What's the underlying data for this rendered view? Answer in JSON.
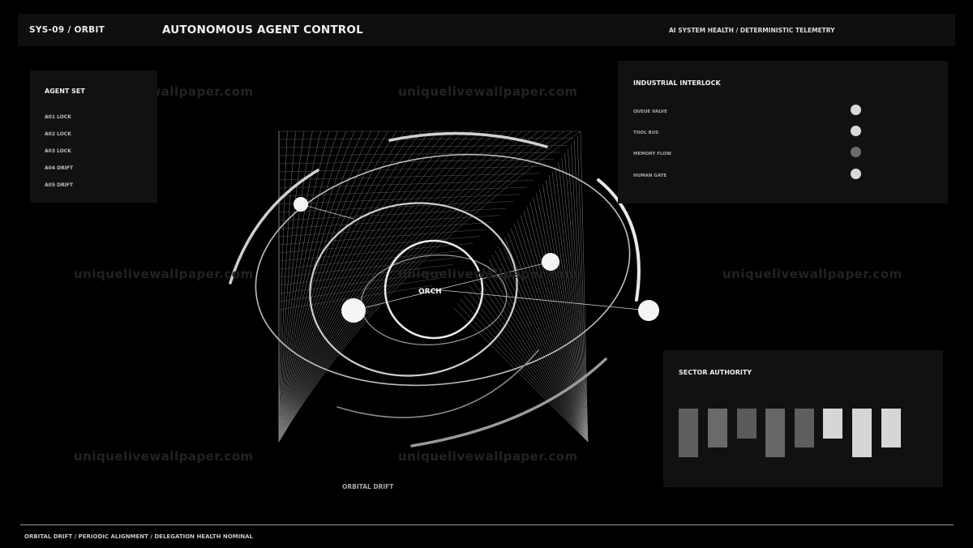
{
  "header": {
    "system_id": "SYS-09 / ORBIT",
    "title": "AUTONOMOUS AGENT CONTROL",
    "health": "AI SYSTEM HEALTH / DETERMINISTIC TELEMETRY"
  },
  "agent_set": {
    "title": "AGENT SET",
    "items": [
      "A01 LOCK",
      "A02 LOCK",
      "A03 LOCK",
      "A04 DRIFT",
      "A05 DRIFT"
    ]
  },
  "interlock": {
    "title": "INDUSTRIAL INTERLOCK",
    "items": [
      {
        "label": "QUEUE VALVE",
        "color": "#d9d9d9"
      },
      {
        "label": "TOOL BUS",
        "color": "#d9d9d9"
      },
      {
        "label": "MEMORY FLOW",
        "color": "#6b6b6b"
      },
      {
        "label": "HUMAN GATE",
        "color": "#d9d9d9"
      }
    ]
  },
  "sector_authority": {
    "title": "SECTOR AUTHORITY"
  },
  "orbit": {
    "center_label": "ORCH",
    "caption": "ORBITAL DRIFT"
  },
  "footer": {
    "text": "ORBITAL DRIFT / PERIODIC ALIGNMENT / DELEGATION HEALTH NOMINAL"
  },
  "watermark": "uniquelivewallpaper.com"
}
